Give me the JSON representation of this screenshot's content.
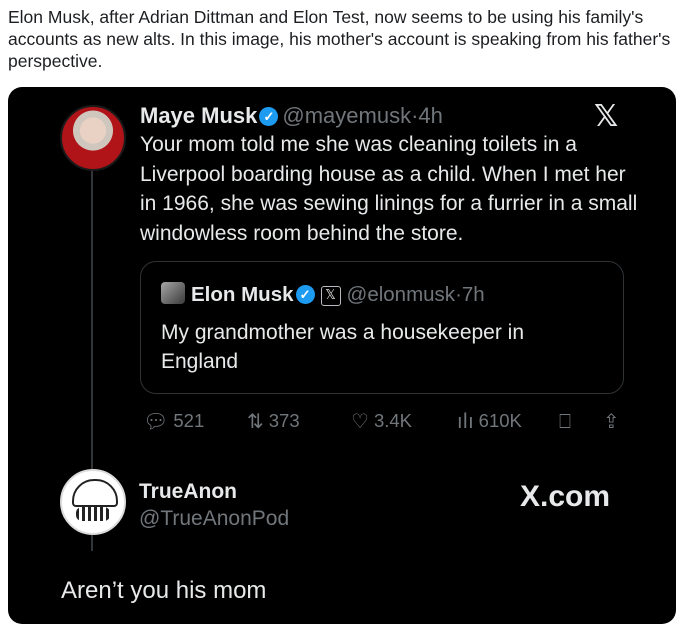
{
  "caption": "Elon Musk, after Adrian Dittman and Elon Test, now seems to be using his family's accounts as new alts. In this image, his mother's account is speaking from his father's perspective.",
  "main_tweet": {
    "name": "Maye Musk",
    "handle": "@mayemusk",
    "time": "4h",
    "text": "Your mom told me she was cleaning toilets in a Liverpool boarding house as a child. When I met her in 1966, she was sewing linings for a furrier in a small windowless room behind the store.",
    "platform_logo": "𝕏"
  },
  "quoted_tweet": {
    "name": "Elon Musk",
    "handle": "@elonmusk",
    "time": "7h",
    "text": "My grandmother was a housekeeper in England"
  },
  "actions": {
    "replies": "521",
    "reposts": "373",
    "likes": "3.4K",
    "views": "610K"
  },
  "reply": {
    "name": "TrueAnon",
    "handle": "@TrueAnonPod",
    "source": "X.com",
    "text": "Aren’t you his mom"
  },
  "colors": {
    "background": "#000000",
    "text": "#e7e9ea",
    "muted": "#71767b",
    "verified": "#1d9bf0"
  }
}
